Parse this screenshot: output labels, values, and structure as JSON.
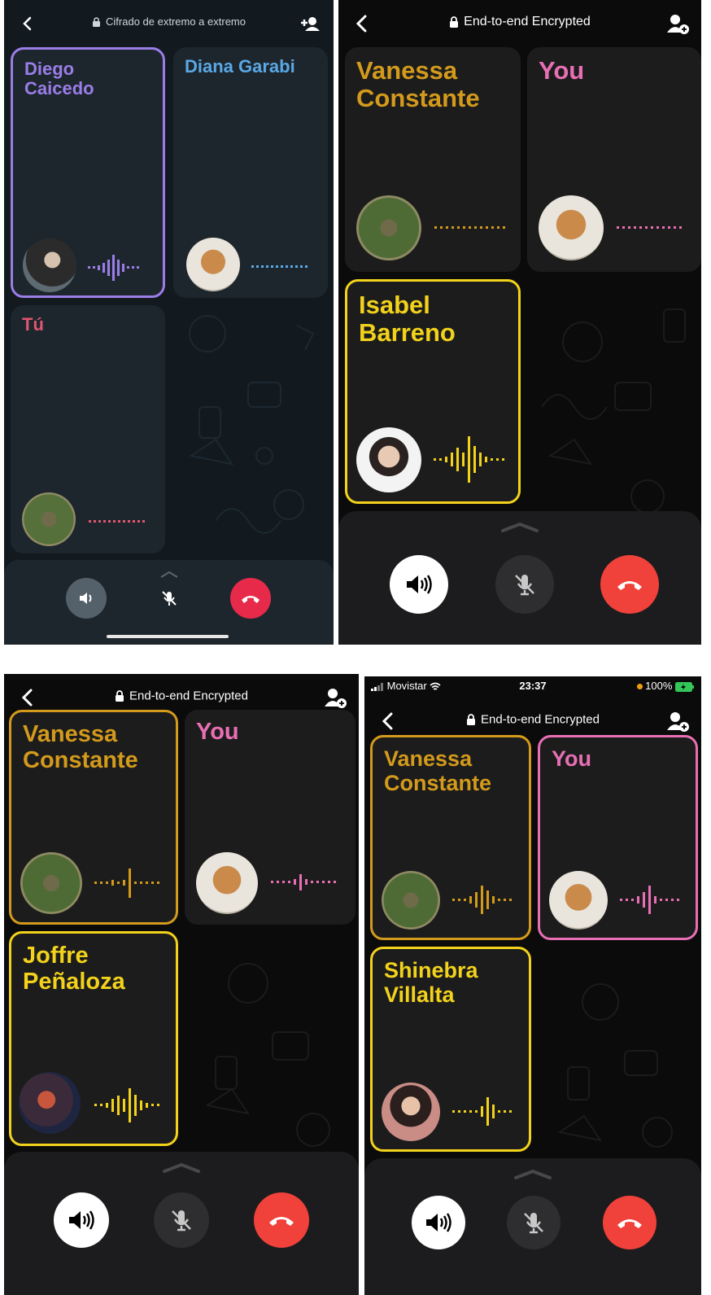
{
  "colors": {
    "purple": "#9b7de8",
    "blue": "#5aa8e6",
    "pink_android": "#e05570",
    "gold": "#d39a1c",
    "yellow": "#f2d21b",
    "pink": "#e86fb4",
    "end_call": "#f0413a"
  },
  "screens": [
    {
      "header": {
        "title": "Cifrado de extremo a extremo",
        "back_icon": "chevron-left-icon",
        "add_icon": "add-person-icon"
      },
      "tiles": [
        {
          "name": "Diego\nCaicedo",
          "active": true
        },
        {
          "name": "Diana Garabi",
          "active": false
        },
        {
          "name": "Tú",
          "active": false
        }
      ],
      "controls": {
        "speaker": "speaker-icon",
        "mute": "mic-off-icon",
        "end": "end-call-icon"
      }
    },
    {
      "header": {
        "title": "End-to-end Encrypted",
        "back_icon": "chevron-left-icon",
        "add_icon": "add-person-icon"
      },
      "tiles": [
        {
          "name": "Vanessa\nConstante",
          "active": false
        },
        {
          "name": "You",
          "active": false
        },
        {
          "name": "Isabel\nBarreno",
          "active": true
        }
      ],
      "controls": {
        "speaker": "speaker-icon",
        "mute": "mic-off-icon",
        "end": "end-call-icon"
      }
    },
    {
      "header": {
        "title": "End-to-end Encrypted",
        "back_icon": "chevron-left-icon",
        "add_icon": "add-person-icon"
      },
      "tiles": [
        {
          "name": "Vanessa\nConstante",
          "active": true
        },
        {
          "name": "You",
          "active": false
        },
        {
          "name": "Joffre\nPeñaloza",
          "active": true
        }
      ],
      "controls": {
        "speaker": "speaker-icon",
        "mute": "mic-off-icon",
        "end": "end-call-icon"
      }
    },
    {
      "status_bar": {
        "carrier": "Movistar",
        "time": "23:37",
        "battery": "100%"
      },
      "header": {
        "title": "End-to-end Encrypted",
        "back_icon": "chevron-left-icon",
        "add_icon": "add-person-icon"
      },
      "tiles": [
        {
          "name": "Vanessa\nConstante",
          "active": true
        },
        {
          "name": "You",
          "active": true
        },
        {
          "name": "Shinebra\nVillalta",
          "active": true
        }
      ],
      "controls": {
        "speaker": "speaker-icon",
        "mute": "mic-off-icon",
        "end": "end-call-icon"
      }
    }
  ]
}
